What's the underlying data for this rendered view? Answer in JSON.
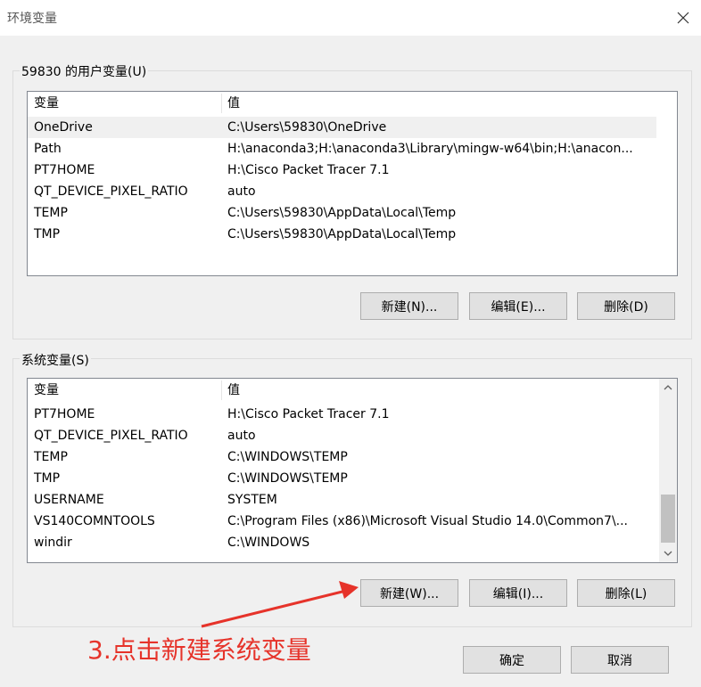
{
  "window": {
    "title": "环境变量"
  },
  "user_group": {
    "label": "59830 的用户变量(U)",
    "columns": [
      "变量",
      "值"
    ],
    "rows": [
      {
        "name": "OneDrive",
        "value": "C:\\Users\\59830\\OneDrive"
      },
      {
        "name": "Path",
        "value": "H:\\anaconda3;H:\\anaconda3\\Library\\mingw-w64\\bin;H:\\anacon..."
      },
      {
        "name": "PT7HOME",
        "value": "H:\\Cisco Packet Tracer 7.1"
      },
      {
        "name": "QT_DEVICE_PIXEL_RATIO",
        "value": "auto"
      },
      {
        "name": "TEMP",
        "value": "C:\\Users\\59830\\AppData\\Local\\Temp"
      },
      {
        "name": "TMP",
        "value": "C:\\Users\\59830\\AppData\\Local\\Temp"
      }
    ],
    "buttons": {
      "new": "新建(N)...",
      "edit": "编辑(E)...",
      "delete": "删除(D)"
    }
  },
  "system_group": {
    "label": "系统变量(S)",
    "columns": [
      "变量",
      "值"
    ],
    "rows": [
      {
        "name": "PT7HOME",
        "value": "H:\\Cisco Packet Tracer 7.1"
      },
      {
        "name": "QT_DEVICE_PIXEL_RATIO",
        "value": "auto"
      },
      {
        "name": "TEMP",
        "value": "C:\\WINDOWS\\TEMP"
      },
      {
        "name": "TMP",
        "value": "C:\\WINDOWS\\TEMP"
      },
      {
        "name": "USERNAME",
        "value": "SYSTEM"
      },
      {
        "name": "VS140COMNTOOLS",
        "value": "C:\\Program Files (x86)\\Microsoft Visual Studio 14.0\\Common7\\..."
      },
      {
        "name": "windir",
        "value": "C:\\WINDOWS"
      }
    ],
    "buttons": {
      "new": "新建(W)...",
      "edit": "编辑(I)...",
      "delete": "删除(L)"
    }
  },
  "footer": {
    "ok": "确定",
    "cancel": "取消"
  },
  "annotation": {
    "text": "3.点击新建系统变量",
    "color": "#e6332a"
  }
}
